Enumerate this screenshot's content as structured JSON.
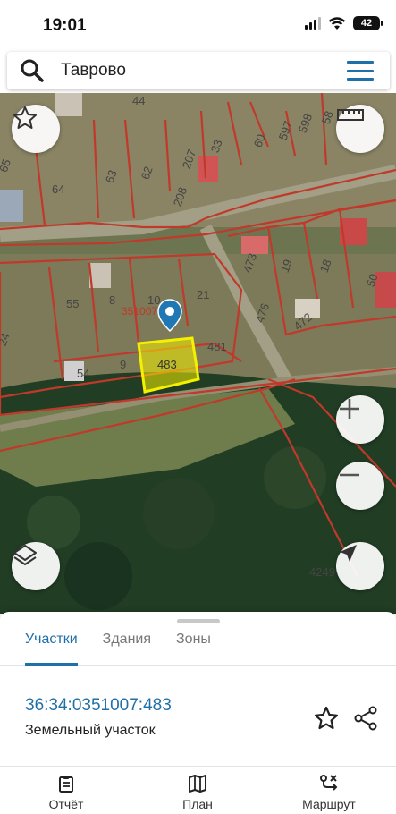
{
  "status_bar": {
    "time": "19:01",
    "battery": "42"
  },
  "search": {
    "query": "Таврово"
  },
  "map": {
    "lot_labels": [
      "44",
      "58",
      "65",
      "64",
      "63",
      "62",
      "207",
      "208",
      "33",
      "60",
      "597",
      "598",
      "473",
      "19",
      "18",
      "50",
      "476",
      "472",
      "55",
      "8",
      "10",
      "21",
      "24",
      "54",
      "9",
      "483",
      "481",
      "4249"
    ],
    "quarter_label": "351007",
    "selected_lot": "483"
  },
  "sheet": {
    "tabs": [
      "Участки",
      "Здания",
      "Зоны"
    ],
    "active_tab": "Участки",
    "cadastral_number": "36:34:0351007:483",
    "object_type": "Земельный участок"
  },
  "bottom_nav": {
    "items": [
      "Отчёт",
      "План",
      "Маршрут"
    ]
  },
  "colors": {
    "accent": "#1f6fa8",
    "boundary": "#c0392b",
    "selection": "#f4f000"
  }
}
